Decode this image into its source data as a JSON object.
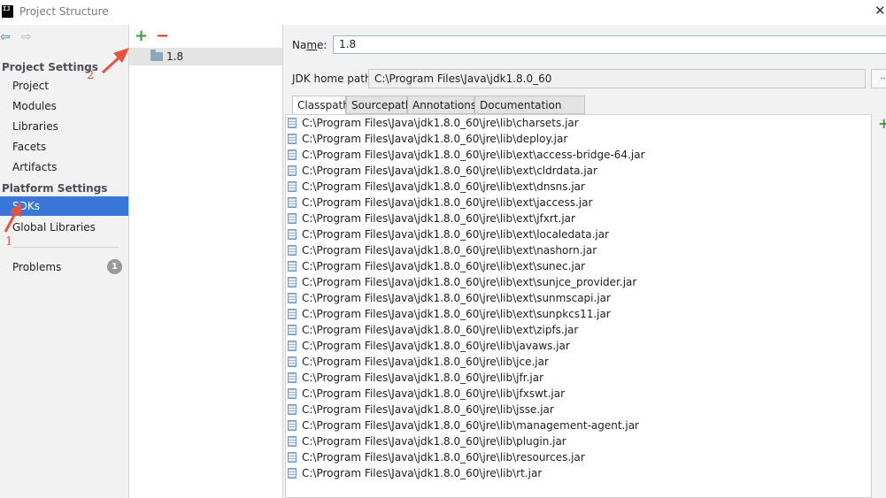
{
  "window": {
    "title": "Project Structure",
    "app_icon_text": "IJ"
  },
  "sidebar": {
    "project_settings_header": "Project Settings",
    "project_items": [
      "Project",
      "Modules",
      "Libraries",
      "Facets",
      "Artifacts"
    ],
    "platform_settings_header": "Platform Settings",
    "platform_items": [
      "SDKs",
      "Global Libraries"
    ],
    "selected_item": "SDKs",
    "problems_label": "Problems",
    "problems_count": "1"
  },
  "sdk_list": {
    "add_label": "+",
    "remove_label": "−",
    "items": [
      "1.8"
    ]
  },
  "detail": {
    "name_label_prefix": "Na",
    "name_label_mnemonic": "m",
    "name_label_suffix": "e:",
    "name_value": "1.8",
    "jdk_home_label": "JDK home path:",
    "jdk_home_value": "C:\\Program Files\\Java\\jdk1.8.0_60",
    "browse_label": "...",
    "tabs": [
      "Classpath",
      "Sourcepath",
      "Annotations",
      "Documentation Paths"
    ],
    "active_tab": "Classpath",
    "list_add_label": "+",
    "classpath": [
      "C:\\Program Files\\Java\\jdk1.8.0_60\\jre\\lib\\charsets.jar",
      "C:\\Program Files\\Java\\jdk1.8.0_60\\jre\\lib\\deploy.jar",
      "C:\\Program Files\\Java\\jdk1.8.0_60\\jre\\lib\\ext\\access-bridge-64.jar",
      "C:\\Program Files\\Java\\jdk1.8.0_60\\jre\\lib\\ext\\cldrdata.jar",
      "C:\\Program Files\\Java\\jdk1.8.0_60\\jre\\lib\\ext\\dnsns.jar",
      "C:\\Program Files\\Java\\jdk1.8.0_60\\jre\\lib\\ext\\jaccess.jar",
      "C:\\Program Files\\Java\\jdk1.8.0_60\\jre\\lib\\ext\\jfxrt.jar",
      "C:\\Program Files\\Java\\jdk1.8.0_60\\jre\\lib\\ext\\localedata.jar",
      "C:\\Program Files\\Java\\jdk1.8.0_60\\jre\\lib\\ext\\nashorn.jar",
      "C:\\Program Files\\Java\\jdk1.8.0_60\\jre\\lib\\ext\\sunec.jar",
      "C:\\Program Files\\Java\\jdk1.8.0_60\\jre\\lib\\ext\\sunjce_provider.jar",
      "C:\\Program Files\\Java\\jdk1.8.0_60\\jre\\lib\\ext\\sunmscapi.jar",
      "C:\\Program Files\\Java\\jdk1.8.0_60\\jre\\lib\\ext\\sunpkcs11.jar",
      "C:\\Program Files\\Java\\jdk1.8.0_60\\jre\\lib\\ext\\zipfs.jar",
      "C:\\Program Files\\Java\\jdk1.8.0_60\\jre\\lib\\javaws.jar",
      "C:\\Program Files\\Java\\jdk1.8.0_60\\jre\\lib\\jce.jar",
      "C:\\Program Files\\Java\\jdk1.8.0_60\\jre\\lib\\jfr.jar",
      "C:\\Program Files\\Java\\jdk1.8.0_60\\jre\\lib\\jfxswt.jar",
      "C:\\Program Files\\Java\\jdk1.8.0_60\\jre\\lib\\jsse.jar",
      "C:\\Program Files\\Java\\jdk1.8.0_60\\jre\\lib\\management-agent.jar",
      "C:\\Program Files\\Java\\jdk1.8.0_60\\jre\\lib\\plugin.jar",
      "C:\\Program Files\\Java\\jdk1.8.0_60\\jre\\lib\\resources.jar",
      "C:\\Program Files\\Java\\jdk1.8.0_60\\jre\\lib\\rt.jar"
    ]
  },
  "annotations": {
    "step1": "1",
    "step2": "2"
  },
  "colors": {
    "accent": "#3976d8",
    "annotation": "#e8543a",
    "add": "#3a9d3a",
    "remove": "#d83b3b"
  }
}
